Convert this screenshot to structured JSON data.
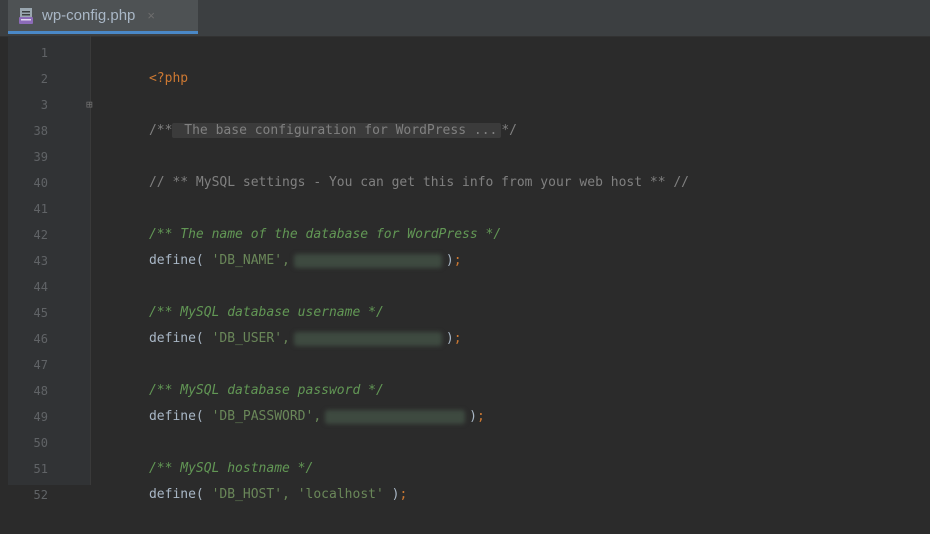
{
  "tab": {
    "filename": "wp-config.php",
    "close": "×",
    "icon": "php-file-icon"
  },
  "gutter": {
    "line_numbers": [
      "1",
      "2",
      "3",
      "38",
      "39",
      "40",
      "41",
      "42",
      "43",
      "44",
      "45",
      "46",
      "47",
      "48",
      "49",
      "50",
      "51",
      "52"
    ]
  },
  "code": {
    "php_open": "<?php",
    "fold_block": "/**",
    "fold_block_text": " The base configuration for WordPress ...",
    "fold_block_end": "*/",
    "settings_comment": "// ** MySQL settings - You can get this info from your web host ** //",
    "db_name_comment": "/** The name of the database for WordPress */",
    "db_user_comment": "/** MySQL database username */",
    "db_password_comment": "/** MySQL database password */",
    "db_host_comment": "/** MySQL hostname */",
    "define_kw": "define(",
    "db_name_key": "'DB_NAME',",
    "db_user_key": "'DB_USER',",
    "db_password_key": "'DB_PASSWORD',",
    "db_host_key": "'DB_HOST',",
    "localhost": "'localhost'",
    "close_paren": ")",
    "semicolon": ";"
  },
  "colors": {
    "background": "#2b2b2b",
    "gutter": "#313335",
    "keyword_orange": "#cc7832",
    "string_green": "#6a8759",
    "doc_comment": "#629755",
    "tab_accent": "#4a88c7"
  }
}
